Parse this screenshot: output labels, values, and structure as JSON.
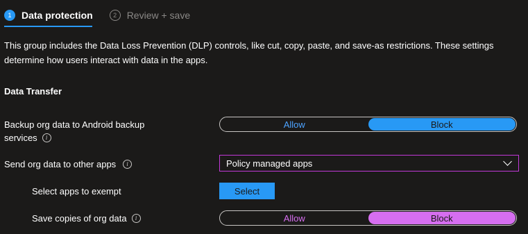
{
  "wizard": {
    "steps": [
      {
        "number": "1",
        "label": "Data protection"
      },
      {
        "number": "2",
        "label": "Review + save"
      }
    ]
  },
  "description": "This group includes the Data Loss Prevention (DLP) controls, like cut, copy, paste, and save-as restrictions. These settings determine how users interact with data in the apps.",
  "section_title": "Data Transfer",
  "settings": {
    "backup": {
      "label_line1": "Backup org data to Android backup",
      "label_line2": "services",
      "allow": "Allow",
      "block": "Block",
      "selected": "Block"
    },
    "send_org_data": {
      "label": "Send org data to other apps",
      "value": "Policy managed apps"
    },
    "exempt": {
      "label": "Select apps to exempt",
      "button": "Select"
    },
    "save_copies": {
      "label": "Save copies of org data",
      "allow": "Allow",
      "block": "Block",
      "selected": "Block"
    }
  },
  "colors": {
    "accent": "#2899f5",
    "highlight": "#d66ef0",
    "background": "#1b1a19"
  }
}
